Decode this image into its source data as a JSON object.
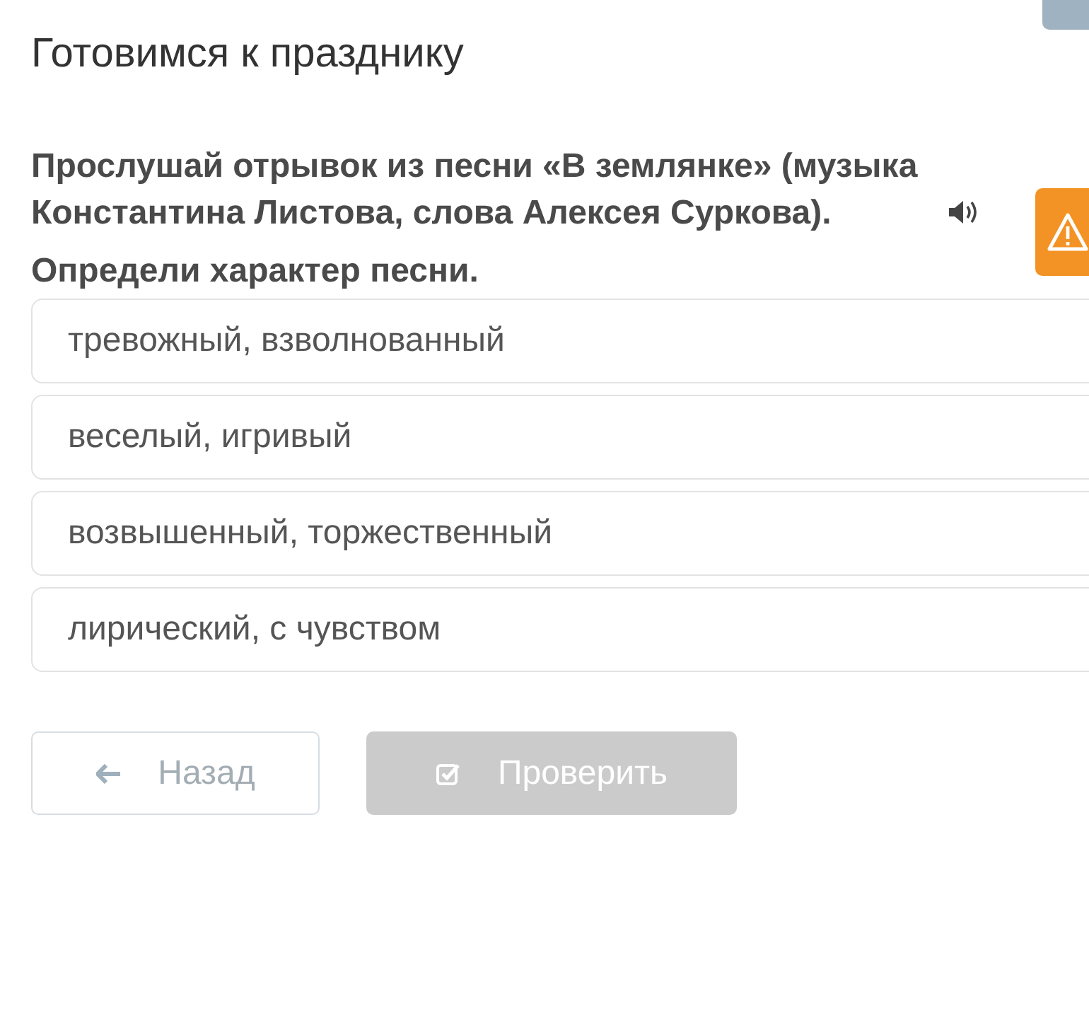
{
  "title": "Готовимся к празднику",
  "question": {
    "text": "Прослушай отрывок из песни «В землянке» (музыка Константина Листова, слова Алексея Суркова).",
    "prompt": "Определи характер песни."
  },
  "options": [
    {
      "label": "тревожный, взволнованный",
      "selected": false
    },
    {
      "label": "веселый, игривый",
      "selected": false
    },
    {
      "label": "возвышенный, торжественный",
      "selected": false
    },
    {
      "label": "лирический, с чувством",
      "selected": false
    }
  ],
  "buttons": {
    "back": {
      "label": "Назад"
    },
    "check": {
      "label": "Проверить",
      "disabled": true
    }
  }
}
